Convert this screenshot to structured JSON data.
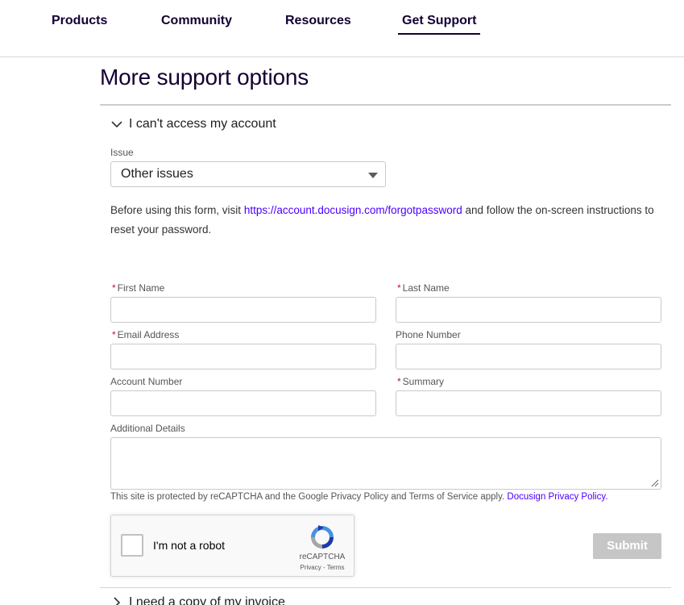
{
  "nav": {
    "items": [
      {
        "label": "Products"
      },
      {
        "label": "Community"
      },
      {
        "label": "Resources"
      },
      {
        "label": "Get Support",
        "active": true
      }
    ]
  },
  "page": {
    "title": "More support options"
  },
  "accordion": {
    "open_title": "I can't access my account",
    "next_title": "I need a copy of my invoice"
  },
  "issue": {
    "label": "Issue",
    "selected": "Other issues"
  },
  "info": {
    "before": "Before using this form, visit ",
    "link": "https://account.docusign.com/forgotpassword",
    "after": " and follow the on-screen instructions to reset your password."
  },
  "form": {
    "first_name_label": "First Name",
    "last_name_label": "Last Name",
    "email_label": "Email Address",
    "phone_label": "Phone Number",
    "account_label": "Account Number",
    "summary_label": "Summary",
    "details_label": "Additional Details",
    "required_marker": "*"
  },
  "legal": {
    "text": "This site is protected by reCAPTCHA and the Google Privacy Policy and Terms of Service apply.",
    "link": "Docusign Privacy Policy."
  },
  "recaptcha": {
    "label": "I'm not a robot",
    "brand": "reCAPTCHA",
    "links": "Privacy - Terms"
  },
  "submit": {
    "label": "Submit"
  },
  "colors": {
    "brand_dark": "#130032",
    "link": "#4c00ff",
    "required": "#c8102e",
    "submit_disabled": "#c6c6c6"
  }
}
